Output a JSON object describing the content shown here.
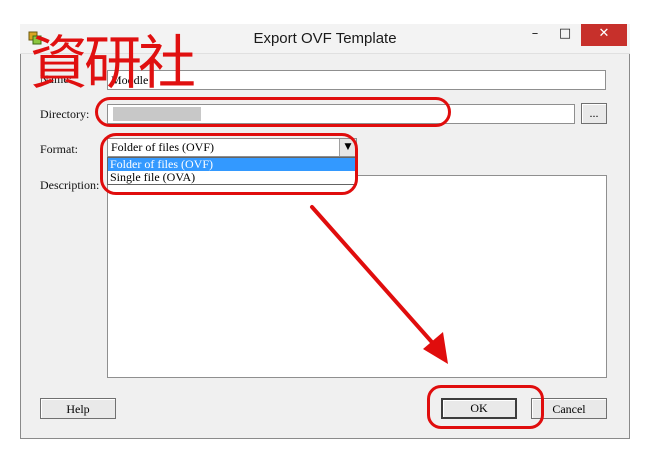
{
  "window": {
    "title": "Export OVF Template",
    "minimize": "–",
    "maximize": "□",
    "close": "✕"
  },
  "form": {
    "name_label": "Name:",
    "name_value": "Moodle",
    "directory_label": "Directory:",
    "directory_value": "",
    "browse_label": "...",
    "format_label": "Format:",
    "format_selected": "Folder of files (OVF)",
    "format_options": [
      "Folder of files (OVF)",
      "Single file (OVA)"
    ],
    "description_label": "Description:",
    "description_value": ""
  },
  "buttons": {
    "help": "Help",
    "ok": "OK",
    "cancel": "Cancel"
  },
  "overlay": {
    "watermark_text": "資研社"
  },
  "colors": {
    "annotation_red": "#e00d0d",
    "selection_blue": "#3399ff",
    "close_red": "#c7302b"
  }
}
